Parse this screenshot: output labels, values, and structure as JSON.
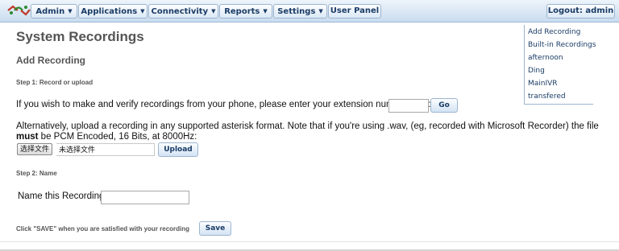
{
  "menu": {
    "items": [
      {
        "label": "Admin",
        "has_arrow": true
      },
      {
        "label": "Applications",
        "has_arrow": true
      },
      {
        "label": "Connectivity",
        "has_arrow": true
      },
      {
        "label": "Reports",
        "has_arrow": true
      },
      {
        "label": "Settings",
        "has_arrow": true
      },
      {
        "label": "User Panel",
        "has_arrow": false
      }
    ],
    "logout": "Logout: admin",
    "logo_icon": "freepbx-logo-icon"
  },
  "page": {
    "title": "System Recordings",
    "section": "Add Recording",
    "step1": "Step 1: Record or upload",
    "phone_text": "If you wish to make and verify recordings from your phone, please enter your extension number here:",
    "go_label": "Go",
    "upload_text_before": "Alternatively, upload a recording in any supported asterisk format. Note that if you're using .wav, (eg, recorded with Microsoft Recorder) the file ",
    "upload_text_bold": "must",
    "upload_text_after": " be PCM Encoded, 16 Bits, at 8000Hz:",
    "choose_file_label": "选择文件",
    "no_file_label": "未选择文件",
    "upload_label": "Upload",
    "step2": "Step 2: Name",
    "name_label": "Name this Recording:",
    "save_hint": "Click \"SAVE\" when you are satisfied with your recording",
    "save_label": "Save"
  },
  "sidebar": {
    "items": [
      "Add Recording",
      "Built-in Recordings",
      "afternoon",
      "Ding",
      "MainIVR",
      "transfered"
    ]
  },
  "colors": {
    "menu_text": "#1a3c66",
    "title_gray": "#555555",
    "bar_top": "#eef4fb",
    "bar_bottom": "#c9dcef"
  }
}
